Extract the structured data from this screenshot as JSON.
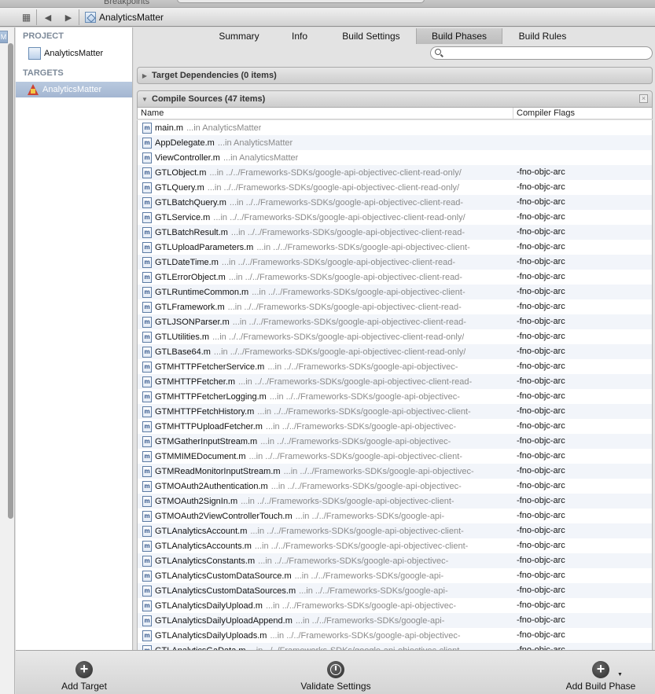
{
  "top": {
    "breakpoints_label": "Breakpoints"
  },
  "jumpbar": {
    "crumb": "AnalyticsMatter"
  },
  "navigator": {
    "project_header": "PROJECT",
    "project_name": "AnalyticsMatter",
    "targets_header": "TARGETS",
    "target_name": "AnalyticsMatter"
  },
  "tabs": [
    "Summary",
    "Info",
    "Build Settings",
    "Build Phases",
    "Build Rules"
  ],
  "active_tab": "Build Phases",
  "phases": {
    "dependencies_title": "Target Dependencies (0 items)",
    "compile_title": "Compile Sources (47 items)",
    "col_name": "Name",
    "col_flags": "Compiler Flags"
  },
  "files": [
    {
      "name": "main.m",
      "path": "...in AnalyticsMatter",
      "flags": ""
    },
    {
      "name": "AppDelegate.m",
      "path": "...in AnalyticsMatter",
      "flags": ""
    },
    {
      "name": "ViewController.m",
      "path": "...in AnalyticsMatter",
      "flags": ""
    },
    {
      "name": "GTLObject.m",
      "path": "...in ../../Frameworks-SDKs/google-api-objectivec-client-read-only/",
      "flags": "-fno-objc-arc"
    },
    {
      "name": "GTLQuery.m",
      "path": "...in ../../Frameworks-SDKs/google-api-objectivec-client-read-only/",
      "flags": "-fno-objc-arc"
    },
    {
      "name": "GTLBatchQuery.m",
      "path": "...in ../../Frameworks-SDKs/google-api-objectivec-client-read-",
      "flags": "-fno-objc-arc"
    },
    {
      "name": "GTLService.m",
      "path": "...in ../../Frameworks-SDKs/google-api-objectivec-client-read-only/",
      "flags": "-fno-objc-arc"
    },
    {
      "name": "GTLBatchResult.m",
      "path": "...in ../../Frameworks-SDKs/google-api-objectivec-client-read-",
      "flags": "-fno-objc-arc"
    },
    {
      "name": "GTLUploadParameters.m",
      "path": "...in ../../Frameworks-SDKs/google-api-objectivec-client-",
      "flags": "-fno-objc-arc"
    },
    {
      "name": "GTLDateTime.m",
      "path": "...in ../../Frameworks-SDKs/google-api-objectivec-client-read-",
      "flags": "-fno-objc-arc"
    },
    {
      "name": "GTLErrorObject.m",
      "path": "...in ../../Frameworks-SDKs/google-api-objectivec-client-read-",
      "flags": "-fno-objc-arc"
    },
    {
      "name": "GTLRuntimeCommon.m",
      "path": "...in ../../Frameworks-SDKs/google-api-objectivec-client-",
      "flags": "-fno-objc-arc"
    },
    {
      "name": "GTLFramework.m",
      "path": "...in ../../Frameworks-SDKs/google-api-objectivec-client-read-",
      "flags": "-fno-objc-arc"
    },
    {
      "name": "GTLJSONParser.m",
      "path": "...in ../../Frameworks-SDKs/google-api-objectivec-client-read-",
      "flags": "-fno-objc-arc"
    },
    {
      "name": "GTLUtilities.m",
      "path": "...in ../../Frameworks-SDKs/google-api-objectivec-client-read-only/",
      "flags": "-fno-objc-arc"
    },
    {
      "name": "GTLBase64.m",
      "path": "...in ../../Frameworks-SDKs/google-api-objectivec-client-read-only/",
      "flags": "-fno-objc-arc"
    },
    {
      "name": "GTMHTTPFetcherService.m",
      "path": "...in ../../Frameworks-SDKs/google-api-objectivec-",
      "flags": "-fno-objc-arc"
    },
    {
      "name": "GTMHTTPFetcher.m",
      "path": "...in ../../Frameworks-SDKs/google-api-objectivec-client-read-",
      "flags": "-fno-objc-arc"
    },
    {
      "name": "GTMHTTPFetcherLogging.m",
      "path": "...in ../../Frameworks-SDKs/google-api-objectivec-",
      "flags": "-fno-objc-arc"
    },
    {
      "name": "GTMHTTPFetchHistory.m",
      "path": "...in ../../Frameworks-SDKs/google-api-objectivec-client-",
      "flags": "-fno-objc-arc"
    },
    {
      "name": "GTMHTTPUploadFetcher.m",
      "path": "...in ../../Frameworks-SDKs/google-api-objectivec-",
      "flags": "-fno-objc-arc"
    },
    {
      "name": "GTMGatherInputStream.m",
      "path": "...in ../../Frameworks-SDKs/google-api-objectivec-",
      "flags": "-fno-objc-arc"
    },
    {
      "name": "GTMMIMEDocument.m",
      "path": "...in ../../Frameworks-SDKs/google-api-objectivec-client-",
      "flags": "-fno-objc-arc"
    },
    {
      "name": "GTMReadMonitorInputStream.m",
      "path": "...in ../../Frameworks-SDKs/google-api-objectivec-",
      "flags": "-fno-objc-arc"
    },
    {
      "name": "GTMOAuth2Authentication.m",
      "path": "...in ../../Frameworks-SDKs/google-api-objectivec-",
      "flags": "-fno-objc-arc"
    },
    {
      "name": "GTMOAuth2SignIn.m",
      "path": "...in ../../Frameworks-SDKs/google-api-objectivec-client-",
      "flags": "-fno-objc-arc"
    },
    {
      "name": "GTMOAuth2ViewControllerTouch.m",
      "path": "...in ../../Frameworks-SDKs/google-api-",
      "flags": "-fno-objc-arc"
    },
    {
      "name": "GTLAnalyticsAccount.m",
      "path": "...in ../../Frameworks-SDKs/google-api-objectivec-client-",
      "flags": "-fno-objc-arc"
    },
    {
      "name": "GTLAnalyticsAccounts.m",
      "path": "...in ../../Frameworks-SDKs/google-api-objectivec-client-",
      "flags": "-fno-objc-arc"
    },
    {
      "name": "GTLAnalyticsConstants.m",
      "path": "...in ../../Frameworks-SDKs/google-api-objectivec-",
      "flags": "-fno-objc-arc"
    },
    {
      "name": "GTLAnalyticsCustomDataSource.m",
      "path": "...in ../../Frameworks-SDKs/google-api-",
      "flags": "-fno-objc-arc"
    },
    {
      "name": "GTLAnalyticsCustomDataSources.m",
      "path": "...in ../../Frameworks-SDKs/google-api-",
      "flags": "-fno-objc-arc"
    },
    {
      "name": "GTLAnalyticsDailyUpload.m",
      "path": "...in ../../Frameworks-SDKs/google-api-objectivec-",
      "flags": "-fno-objc-arc"
    },
    {
      "name": "GTLAnalyticsDailyUploadAppend.m",
      "path": "...in ../../Frameworks-SDKs/google-api-",
      "flags": "-fno-objc-arc"
    },
    {
      "name": "GTLAnalyticsDailyUploads.m",
      "path": "...in ../../Frameworks-SDKs/google-api-objectivec-",
      "flags": "-fno-objc-arc"
    },
    {
      "name": "GTLAnalyticsGaData.m",
      "path": "...in ../../Frameworks-SDKs/google-api-objectivec-client-",
      "flags": "-fno-objc-arc"
    }
  ],
  "bottom": {
    "add_target": "Add Target",
    "validate": "Validate Settings",
    "add_phase": "Add Build Phase"
  }
}
